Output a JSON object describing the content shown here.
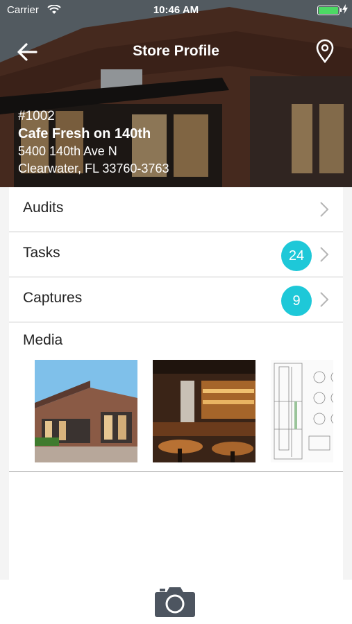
{
  "status_bar": {
    "carrier": "Carrier",
    "time": "10:46 AM"
  },
  "nav": {
    "title": "Store Profile"
  },
  "store": {
    "number": "#1002",
    "name": "Cafe Fresh on 140th",
    "address_line1": "5400 140th Ave N",
    "address_line2": "Clearwater, FL 33760-3763"
  },
  "menu": {
    "audits": {
      "label": "Audits"
    },
    "tasks": {
      "label": "Tasks",
      "badge": "24"
    },
    "captures": {
      "label": "Captures",
      "badge": "9"
    }
  },
  "media": {
    "label": "Media",
    "items": [
      "storefront-photo",
      "bar-interior-photo",
      "floor-plan-drawing"
    ]
  },
  "colors": {
    "badge": "#1ec8d8",
    "battery": "#4cd964"
  }
}
